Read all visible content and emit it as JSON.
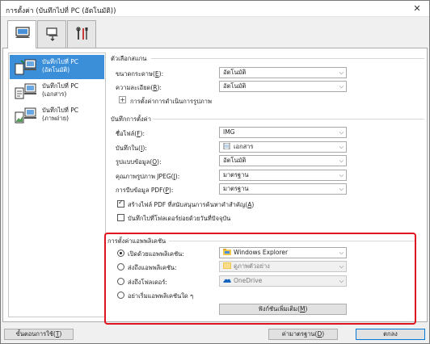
{
  "window": {
    "title": "การตั้งค่า (บันทึกไปที่ PC (อัตโนมัติ))",
    "close_glyph": "✕"
  },
  "tabs": [
    {
      "icon": "computer-icon",
      "active": true
    },
    {
      "icon": "scan-to-computer-icon",
      "active": false
    },
    {
      "icon": "tools-icon",
      "active": false
    }
  ],
  "sidebar": {
    "items": [
      {
        "line1": "บันทึกไปที่ PC",
        "line2": "(อัตโนมัติ)",
        "selected": true
      },
      {
        "line1": "บันทึกไปที่ PC",
        "line2": "(เอกสาร)",
        "selected": false
      },
      {
        "line1": "บันทึกไปที่ PC",
        "line2": "(ภาพถ่าย)",
        "selected": false
      }
    ]
  },
  "scan_options": {
    "title": "ตัวเลือกสแกน",
    "paper_size_label": "ขนาดกระดาษ(",
    "paper_size_key": "E",
    "paper_size_value": "อัตโนมัติ",
    "resolution_label": "ความละเอียด(",
    "resolution_key": "R",
    "resolution_value": "อัตโนมัติ",
    "image_processing_label": "การตั้งค่าการดำเนินการรูปภาพ",
    "expander_glyph": "+"
  },
  "save_settings": {
    "title": "บันทึกการตั้งค่า",
    "file_name_label": "ชื่อไฟล์(",
    "file_name_key": "F",
    "file_name_value": "IMG",
    "save_in_label": "บันทึกใน(",
    "save_in_key": "I",
    "save_in_value": "เอกสาร",
    "data_format_label": "รูปแบบข้อมูล(",
    "data_format_key": "O",
    "data_format_value": "อัตโนมัติ",
    "jpeg_quality_label": "คุณภาพรูปภาพ JPEG(",
    "jpeg_quality_key": "J",
    "jpeg_quality_value": "มาตรฐาน",
    "pdf_compression_label": "การบีบข้อมูล PDF(",
    "pdf_compression_key": "P",
    "pdf_compression_value": "มาตรฐาน",
    "keyword_pdf_label": "สร้างไฟล์ PDF ที่สนับสนุนการค้นหาคำสำคัญ(",
    "keyword_pdf_key": "A",
    "keyword_pdf_checked": true,
    "subfolder_label": "บันทึกไปที่โฟลเดอร์ย่อยด้วยวันที่ปัจจุบัน",
    "subfolder_checked": false
  },
  "app_settings": {
    "title": "การตั้งค่าแอพพลิเคชัน",
    "open_app_label": "เปิดด้วยแอพพลิเคชัน:",
    "open_app_value": "Windows Explorer",
    "send_app_label": "ส่งถึงแอพพลิเคชัน:",
    "send_app_value": "ดูภาพตัวอย่าง",
    "send_folder_label": "ส่งถึงโฟลเดอร์:",
    "send_folder_value": "OneDrive",
    "no_app_label": "อย่าเริ่มแอพพลิเคชันใด ๆ",
    "more_functions_label": "ฟังก์ชันเพิ่มเติม(",
    "more_functions_key": "M",
    "selected_option": "open_app"
  },
  "footer": {
    "instructions_label": "ขั้นตอนการใช้(",
    "instructions_key": "T",
    "defaults_label": "ค่ามาตรฐาน(",
    "defaults_key": "D",
    "ok_label": "ตกลง"
  },
  "combo_arrow": "⌵",
  "colors": {
    "selection": "#3b8fd9",
    "highlight": "#e0141e"
  }
}
